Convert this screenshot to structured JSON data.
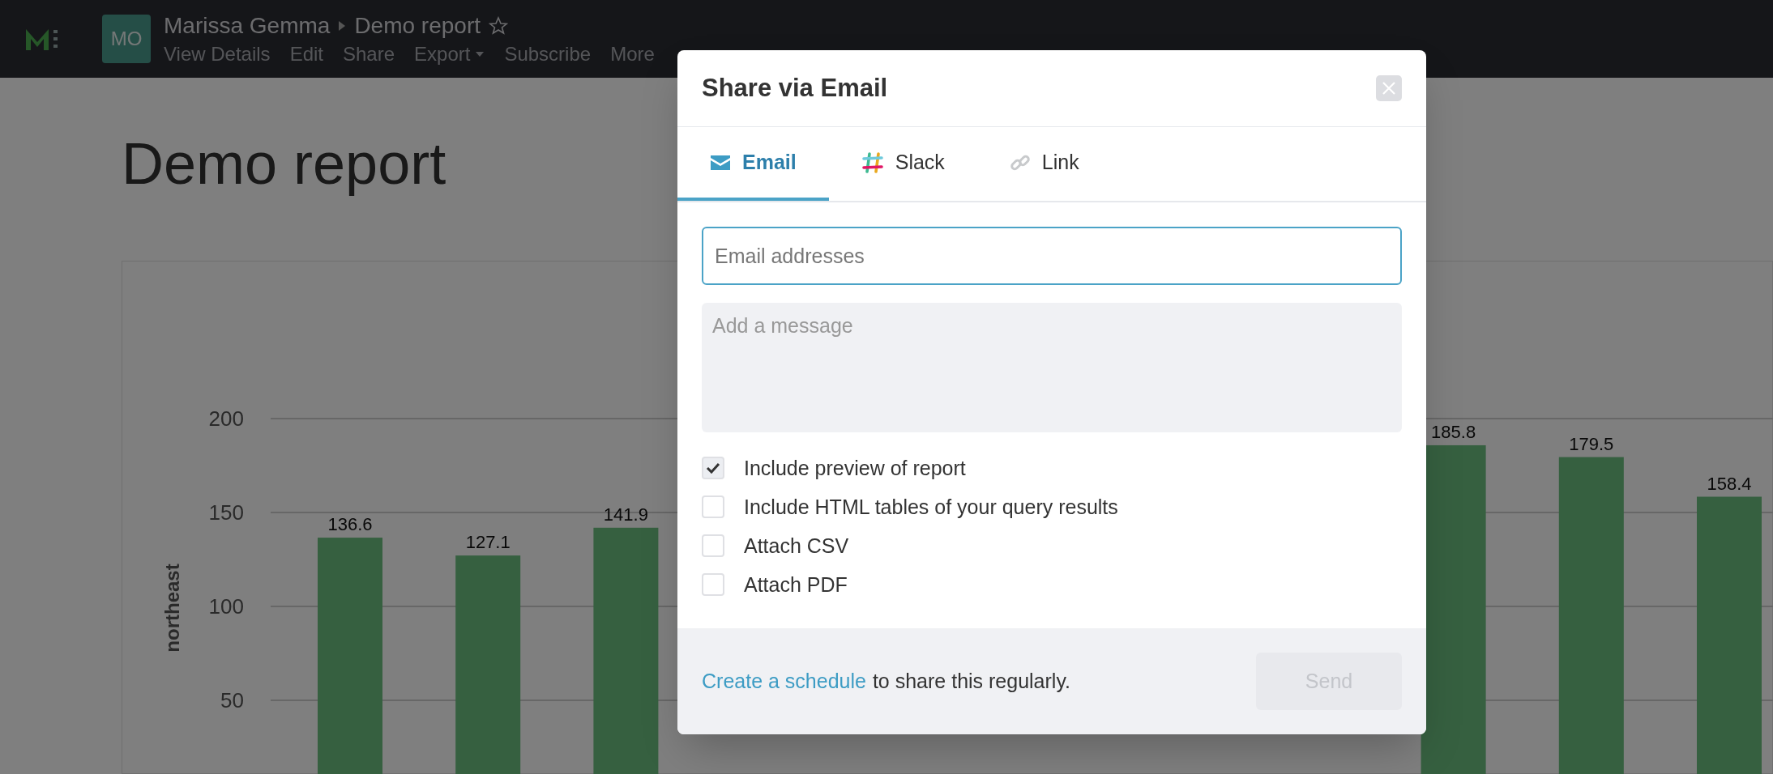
{
  "top_bar": {
    "avatar": "MO",
    "breadcrumb": [
      "Marissa Gemma",
      "Demo report"
    ],
    "favorite": false,
    "menu": [
      {
        "label": "View Details",
        "kind": "link"
      },
      {
        "label": "Edit",
        "kind": "link"
      },
      {
        "label": "Share",
        "kind": "link"
      },
      {
        "label": "Export",
        "kind": "dropdown"
      },
      {
        "label": "Subscribe",
        "kind": "link"
      },
      {
        "label": "More",
        "kind": "link"
      }
    ]
  },
  "report": {
    "title": "Demo report",
    "chart_data": {
      "type": "bar",
      "ylabel": "northeast",
      "ylim": [
        0,
        200
      ],
      "grid": true,
      "yticks": [
        50,
        100,
        150,
        200
      ],
      "data_labels": true,
      "values": [
        136.6,
        127.1,
        141.9,
        null,
        null,
        null,
        null,
        null,
        185.8,
        179.5,
        158.4
      ]
    }
  },
  "dialog": {
    "title": "Share via Email",
    "tabs": [
      {
        "label": "Email",
        "kind": "email",
        "selected": true
      },
      {
        "label": "Slack",
        "kind": "slack",
        "selected": false
      },
      {
        "label": "Link",
        "kind": "link",
        "selected": false
      }
    ],
    "email_field": {
      "placeholder": "Email addresses",
      "focused": true
    },
    "message_field": {
      "placeholder": "Add a message"
    },
    "options": [
      {
        "label": "Include preview of report",
        "checked": true
      },
      {
        "label": "Include HTML tables of your query results",
        "checked": false
      },
      {
        "label": "Attach CSV",
        "checked": false
      },
      {
        "label": "Attach PDF",
        "checked": false
      }
    ],
    "footer": {
      "link": "Create a schedule",
      "text": "to share this regularly."
    },
    "send_button": {
      "label": "Send",
      "disabled": true
    }
  }
}
